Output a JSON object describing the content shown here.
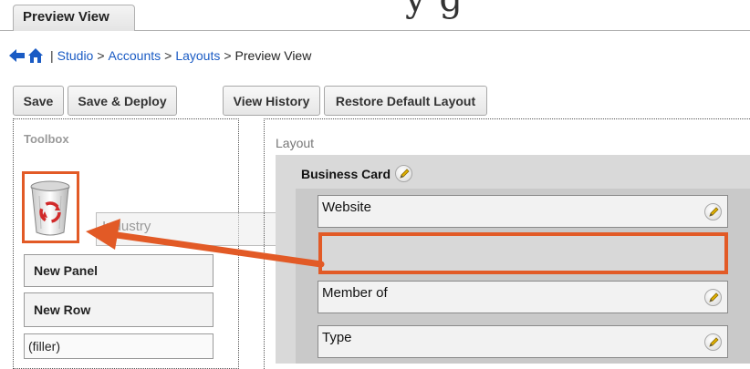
{
  "overlay": {
    "cutoff_caption": "y   g"
  },
  "tab": {
    "label": "Preview View"
  },
  "breadcrumb": {
    "separator": "|",
    "studio": "Studio",
    "arrow": ">",
    "accounts": "Accounts",
    "layouts": "Layouts",
    "current": "Preview View"
  },
  "toolbar": {
    "save": "Save",
    "save_deploy": "Save & Deploy",
    "view_history": "View History",
    "restore_default": "Restore Default Layout"
  },
  "toolbox": {
    "title": "Toolbox",
    "trash_icon": "recycle-bin-icon",
    "items": [
      "New Panel",
      "New Row",
      "(filler)"
    ],
    "dragging_field": "Industry"
  },
  "layout": {
    "title": "Layout",
    "panel_title": "Business Card",
    "fields": [
      "Website",
      "Member of",
      "Type"
    ]
  },
  "colors": {
    "highlight": "#e25a26",
    "link": "#1a5bc4"
  }
}
